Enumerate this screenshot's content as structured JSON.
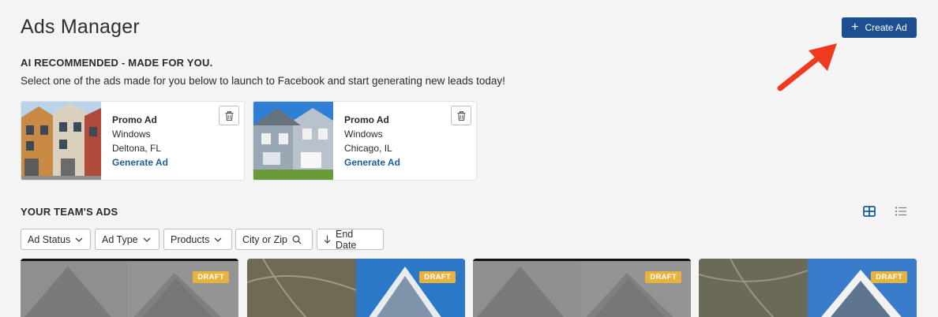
{
  "header": {
    "title": "Ads Manager",
    "create_label": "Create Ad"
  },
  "ai": {
    "heading": "AI RECOMMENDED - MADE FOR YOU.",
    "subtext": "Select one of the ads made for you below to launch to Facebook and start generating new leads today!",
    "cards": [
      {
        "title": "Promo Ad",
        "product": "Windows",
        "location": "Deltona, FL",
        "action": "Generate Ad"
      },
      {
        "title": "Promo Ad",
        "product": "Windows",
        "location": "Chicago, IL",
        "action": "Generate Ad"
      }
    ]
  },
  "team": {
    "heading": "YOUR TEAM'S ADS",
    "filters": {
      "status": "Ad Status",
      "type": "Ad Type",
      "products": "Products",
      "city_placeholder": "City or Zip",
      "end_date": "End Date"
    },
    "ads": [
      {
        "badge": "DRAFT"
      },
      {
        "badge": "DRAFT"
      },
      {
        "badge": "DRAFT"
      },
      {
        "badge": "DRAFT"
      }
    ]
  },
  "colors": {
    "primary": "#1c4f90",
    "link": "#1c5d9e",
    "draft": "#e8b33c",
    "annotation_arrow": "#f03a1f"
  },
  "icons": [
    "plus-icon",
    "trash-icon",
    "grid-view-icon",
    "list-view-icon",
    "chevron-down-icon",
    "search-icon",
    "arrow-down-icon"
  ]
}
